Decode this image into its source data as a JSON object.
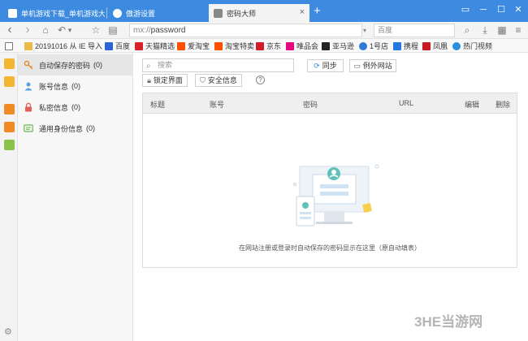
{
  "tabs": [
    {
      "label": "单机游戏下载_单机游戏大全",
      "active": false,
      "icon": "game-site-favicon"
    },
    {
      "label": "傲游设置",
      "active": false,
      "icon": "settings-favicon"
    },
    {
      "label": "密码大师",
      "active": true,
      "icon": "password-master-favicon"
    }
  ],
  "tab_close": "×",
  "new_tab": "+",
  "window_controls": {
    "skin": "▭",
    "minimize": "─",
    "maximize": "☐",
    "close": "✕"
  },
  "nav": {
    "back": "‹",
    "forward": "›",
    "home": "⌂",
    "undo": "↶",
    "dropdown": "▾",
    "favorite": "☆",
    "reading": "▤",
    "address_scheme": "mx://",
    "address_path": "password",
    "search_engine_arrow": "▾",
    "search_placeholder": "百度",
    "search_icon": "⌕",
    "download": "⤓",
    "tools": "▦",
    "menu": "≡"
  },
  "bookmarks": [
    {
      "label": "20191016 从 IE 导入",
      "icon": "folder-icon",
      "color": "#e9b949"
    },
    {
      "label": "百度",
      "icon": "baidu-icon",
      "color": "#2d63d8"
    },
    {
      "label": "天猫精选",
      "icon": "tmall-icon",
      "color": "#d8232a"
    },
    {
      "label": "爱淘宝",
      "icon": "aitaobao-icon",
      "color": "#ff5000"
    },
    {
      "label": "淘宝特卖",
      "icon": "taobao-sale-icon",
      "color": "#ff5000"
    },
    {
      "label": "京东",
      "icon": "jd-icon",
      "color": "#d01e28"
    },
    {
      "label": "唯品会",
      "icon": "vip-icon",
      "color": "#e5087e"
    },
    {
      "label": "亚马逊",
      "icon": "amazon-icon",
      "color": "#222222"
    },
    {
      "label": "1号店",
      "icon": "yhd-icon",
      "color": "#2f79d9"
    },
    {
      "label": "携程",
      "icon": "ctrip-icon",
      "color": "#2577e3"
    },
    {
      "label": "凤凰",
      "icon": "ifeng-icon",
      "color": "#c91a23"
    },
    {
      "label": "热门视频",
      "icon": "video-icon",
      "color": "#2a8fe0"
    }
  ],
  "sidebar": {
    "items": [
      {
        "label": "自动保存的密码",
        "count": "(0)",
        "active": true,
        "icon": "key-icon"
      },
      {
        "label": "账号信息",
        "count": "(0)",
        "active": false,
        "icon": "account-icon"
      },
      {
        "label": "私密信息",
        "count": "(0)",
        "active": false,
        "icon": "lock-icon"
      },
      {
        "label": "通用身份信息",
        "count": "(0)",
        "active": false,
        "icon": "id-card-icon"
      }
    ]
  },
  "main": {
    "search_placeholder": "搜索",
    "sync_button": "同步",
    "exception_sites_button": "例外网站",
    "lock_button": "锁定界面",
    "security_info_button": "安全信息",
    "help": "?",
    "columns": [
      "标题",
      "账号",
      "密码",
      "URL",
      "编辑",
      "删除"
    ],
    "empty_message": "在网站注册或登录时自动保存的密码显示在这里（原自动填表）"
  },
  "watermark": "3HE当游网",
  "colors": {
    "accent": "#3c8be0",
    "tab_active": "#f4f4f4"
  }
}
